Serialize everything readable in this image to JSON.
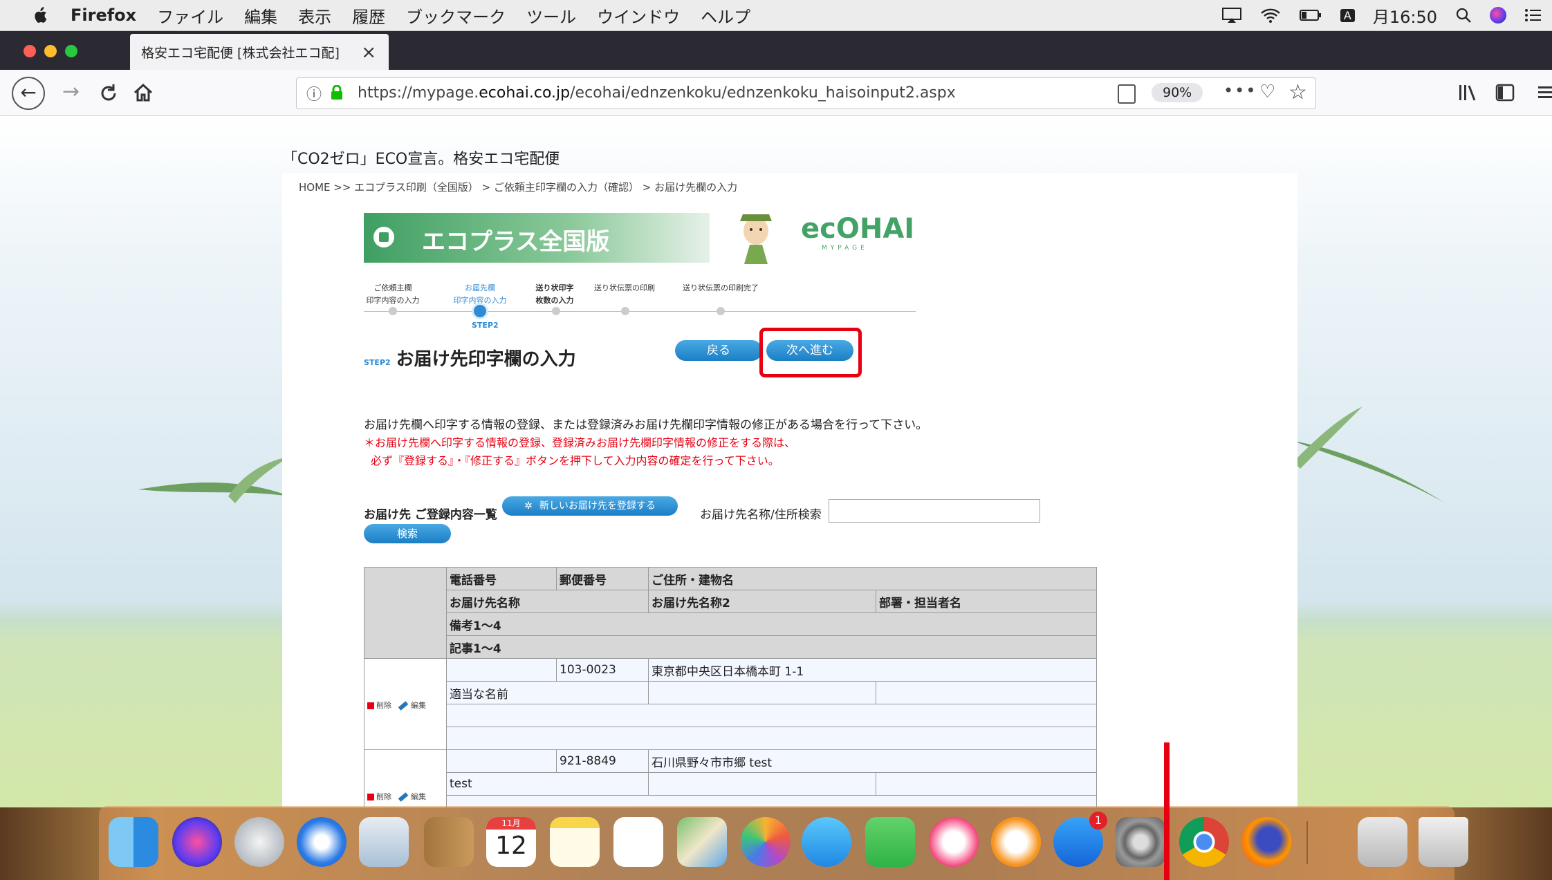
{
  "menubar": {
    "items": [
      "Firefox",
      "ファイル",
      "編集",
      "表示",
      "履歴",
      "ブックマーク",
      "ツール",
      "ウインドウ",
      "ヘルプ"
    ],
    "input_indicator": "A",
    "clock": "月16:50"
  },
  "browser": {
    "tab_title": "格安エコ宅配便 [株式会社エコ配]",
    "tab_close": "×",
    "new_tab": "+",
    "url_prefix": "https://mypage.",
    "url_domain": "ecohai.co.jp",
    "url_path": "/ecohai/ednzenkoku/ednzenkoku_haisoinput2.aspx",
    "zoom": "90%"
  },
  "page": {
    "site_title": "「CO2ゼロ」ECO宣言。格安エコ宅配便",
    "breadcrumb": "HOME >> エコプラス印刷（全国版） > ご依頼主印字欄の入力（確認） > お届け先欄の入力",
    "banner_title": "エコプラス全国版",
    "logo": "ecOHAI",
    "logo_sub": "MYPAGE",
    "steps": [
      {
        "line1": "ご依頼主欄",
        "line2": "印字内容の入力"
      },
      {
        "line1": "お届先欄",
        "line2": "印字内容の入力"
      },
      {
        "line1": "送り状印字",
        "line2": "枚数の入力"
      },
      {
        "line1": "",
        "line2": "送り状伝票の印刷"
      },
      {
        "line1": "",
        "line2": "送り状伝票の印刷完了"
      }
    ],
    "step_label": "STEP2",
    "heading_tag": "STEP2",
    "heading": "お届け先印字欄の入力",
    "back_button": "戻る",
    "next_button": "次へ進む",
    "description": "お届け先欄へ印字する情報の登録、または登録済みお届け先欄印字情報の修正がある場合を行って下さい。",
    "notice_line1": "＊お届け先欄へ印字する情報の登録、登録済みお届け先欄印字情報の修正をする際は、",
    "notice_line2": "必ず『登録する』・『修正する』ボタンを押下して入力内容の確定を行って下さい。",
    "list_title": "お届け先 ご登録内容一覧",
    "register_button": "新しいお届け先を登録する",
    "search_label": "お届け先名称/住所検索",
    "search_value": "",
    "search_button": "検索"
  },
  "table": {
    "headers": {
      "phone": "電話番号",
      "postal": "郵便番号",
      "address": "ご住所・建物名",
      "name1": "お届け先名称",
      "name2": "お届け先名称2",
      "dept": "部署・担当者名",
      "memo": "備考1～4",
      "article": "記事1～4"
    },
    "delete_label": "削除",
    "edit_label": "編集",
    "rows": [
      {
        "phone": "",
        "postal": "103-0023",
        "address": "東京都中央区日本橋本町 1-1",
        "name1": "適当な名前",
        "name2": "",
        "dept": "",
        "memo": "",
        "article": ""
      },
      {
        "phone": "",
        "postal": "921-8849",
        "address": "石川県野々市市郷 test",
        "name1": "test",
        "name2": "",
        "dept": "",
        "memo": "",
        "article": ""
      }
    ]
  },
  "dock": {
    "apps": [
      "finder-icon",
      "siri-icon",
      "launchpad-icon",
      "safari-icon",
      "mail-icon",
      "contacts-icon",
      "calendar-icon",
      "notes-icon",
      "reminders-icon",
      "maps-icon",
      "photos-icon",
      "messages-icon",
      "facetime-icon",
      "itunes-icon",
      "ibooks-icon",
      "app-store-icon",
      "system-preferences-icon",
      "chrome-icon",
      "firefox-icon",
      "downloads-icon",
      "trash-icon"
    ],
    "calendar_month": "11月",
    "calendar_day": "12",
    "appstore_badge": "1"
  },
  "colors": {
    "accent_blue": "#2e8bd4",
    "eco_green": "#43a265",
    "highlight_red": "#e60012"
  }
}
